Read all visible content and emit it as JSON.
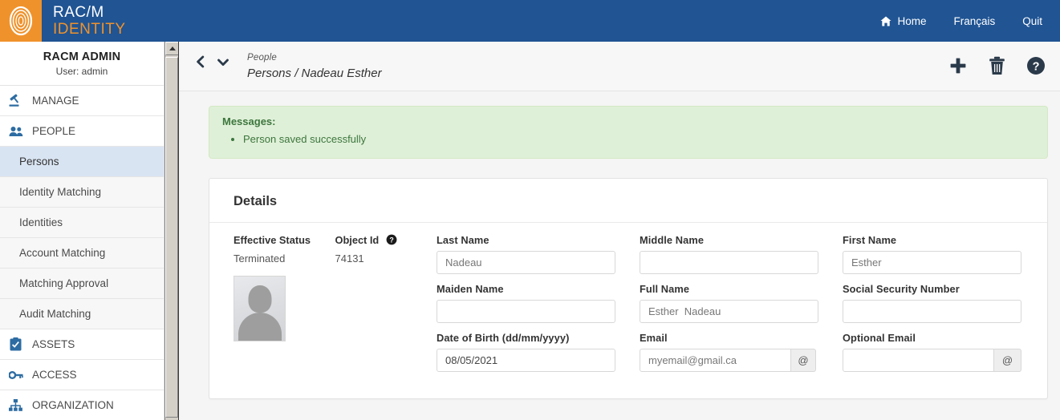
{
  "brand": {
    "line1": "RAC/M",
    "line2": "IDENTITY",
    "logo_icon": "fingerprint-icon",
    "logo_color": "#f0922b",
    "bar_color": "#205493"
  },
  "topnav": {
    "home": "Home",
    "home_icon": "home-icon",
    "francais": "Français",
    "quit": "Quit"
  },
  "sidebar": {
    "user_name": "RACM ADMIN",
    "user_sub": "User: admin",
    "groups": [
      {
        "label": "MANAGE",
        "icon": "gavel-icon"
      },
      {
        "label": "PEOPLE",
        "icon": "people-icon"
      }
    ],
    "people_items": [
      {
        "label": "Persons",
        "active": true
      },
      {
        "label": "Identity Matching",
        "active": false
      },
      {
        "label": "Identities",
        "active": false
      },
      {
        "label": "Account Matching",
        "active": false
      },
      {
        "label": "Matching Approval",
        "active": false
      },
      {
        "label": "Audit Matching",
        "active": false
      }
    ],
    "groups_lower": [
      {
        "label": "ASSETS",
        "icon": "clipboard-check-icon"
      },
      {
        "label": "ACCESS",
        "icon": "key-icon"
      },
      {
        "label": "ORGANIZATION",
        "icon": "sitemap-icon"
      }
    ]
  },
  "breadcrumb": {
    "back_icon": "chevron-left-icon",
    "expand_icon": "chevron-down-icon",
    "section": "People",
    "path": "Persons / Nadeau Esther"
  },
  "toolbar": {
    "add_icon": "plus-icon",
    "delete_icon": "trash-icon",
    "help_icon": "help-circle-icon"
  },
  "alert": {
    "title": "Messages:",
    "items": [
      "Person saved successfully"
    ],
    "bg_color": "#dff0d8",
    "text_color": "#3c763d"
  },
  "details": {
    "title": "Details",
    "fields": {
      "last_name": {
        "label": "Last Name",
        "value": "Nadeau"
      },
      "middle_name": {
        "label": "Middle Name",
        "value": ""
      },
      "first_name": {
        "label": "First Name",
        "value": "Esther"
      },
      "maiden_name": {
        "label": "Maiden Name",
        "value": ""
      },
      "full_name": {
        "label": "Full Name",
        "value": "Esther  Nadeau"
      },
      "ssn": {
        "label": "Social Security Number",
        "value": ""
      },
      "dob": {
        "label": "Date of Birth (dd/mm/yyyy)",
        "value": "08/05/2021"
      },
      "email": {
        "label": "Email",
        "value": "myemail@gmail.ca",
        "addon": "@"
      },
      "optional_email": {
        "label": "Optional Email",
        "value": "",
        "addon": "@"
      }
    },
    "status": {
      "effective_status_label": "Effective Status",
      "effective_status_value": "Terminated",
      "object_id_label": "Object Id",
      "object_id_value": "74131",
      "object_id_help_icon": "help-circle-icon",
      "avatar_icon": "person-placeholder-avatar"
    }
  }
}
